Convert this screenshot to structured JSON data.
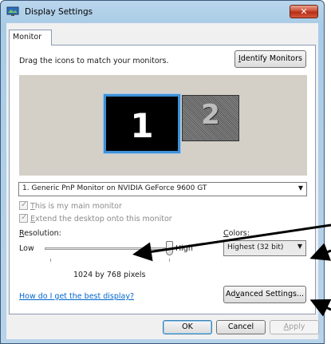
{
  "window": {
    "title": "Display Settings",
    "close_glyph": "✕"
  },
  "tab": {
    "label": "Monitor"
  },
  "main": {
    "instruction": "Drag the icons to match your monitors.",
    "identify_button": {
      "mnemonic": "I",
      "rest": "dentify Monitors"
    },
    "monitors": [
      {
        "number": "1",
        "selected": true
      },
      {
        "number": "2",
        "selected": false
      }
    ],
    "monitor_select": {
      "value": "1. Generic PnP Monitor on NVIDIA GeForce 9600 GT",
      "arrow": "▼"
    },
    "checkbox_main": {
      "mnemonic": "T",
      "rest": "his is my main monitor",
      "checked": true,
      "enabled": false
    },
    "checkbox_extend": {
      "mnemonic": "E",
      "rest": "xtend the desktop onto this monitor",
      "checked": true,
      "enabled": false
    },
    "resolution": {
      "label_mnemonic": "R",
      "label_rest": "esolution:",
      "low": "Low",
      "high": "High",
      "value": "1024 by 768 pixels",
      "slider_position": 1.0
    },
    "colors": {
      "label_mnemonic": "C",
      "label_rest": "olors:",
      "value": "Highest (32 bit)",
      "arrow": "▼"
    },
    "help_link": "How do I get the best display?",
    "advanced_button": {
      "before": "Ad",
      "mnemonic": "v",
      "rest": "anced Settings..."
    }
  },
  "footer": {
    "ok": "OK",
    "cancel": "Cancel",
    "apply_mnemonic": "A",
    "apply_rest": "pply"
  },
  "colors_palette": {
    "link": "#0066cc",
    "selection_border": "#3f8fd6",
    "close_button": "#c8442d",
    "window_frame": "#b9d6ec"
  }
}
